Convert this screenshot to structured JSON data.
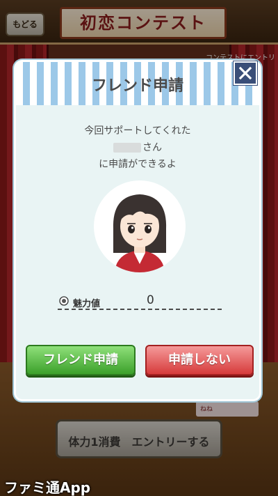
{
  "background": {
    "back_button_label": "もどる",
    "title": "初恋コンテスト",
    "contest_entry_text": "コンテストにエントリ",
    "side_label": "ねね",
    "entry_button_label": "体力1消費　エントリーする",
    "watermark": "ファミ通App"
  },
  "dialog": {
    "title": "フレンド申請",
    "message_line1": "今回サポートしてくれた",
    "message_line2_suffix": "さん",
    "message_line3": "に申請ができるよ",
    "charm_label": "魅力値",
    "charm_value": "0",
    "friend_request_button": "フレンド申請",
    "decline_button": "申請しない",
    "close_icon": "close-icon"
  },
  "colors": {
    "accept": "#3ba02a",
    "decline": "#d63b3b",
    "close": "#3a4e78",
    "stripe": "#9cc8e8"
  }
}
